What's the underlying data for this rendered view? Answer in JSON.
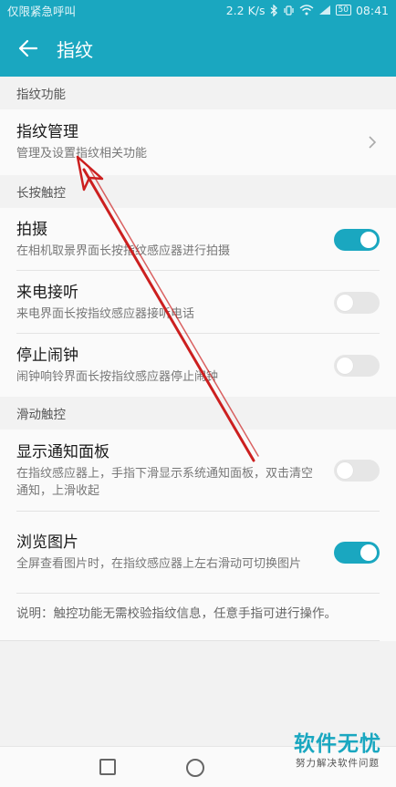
{
  "status_bar": {
    "left_text": "仅限紧急呼叫",
    "speed": "2.2 K/s",
    "icons": [
      "bluetooth-icon",
      "vibrate-icon",
      "wifi-icon",
      "signal-icon"
    ],
    "battery": "50",
    "time": "08:41"
  },
  "app_bar": {
    "back_icon": "arrow-left-icon",
    "title": "指纹"
  },
  "sections": {
    "s1": {
      "header": "指纹功能",
      "manage": {
        "title": "指纹管理",
        "subtitle": "管理及设置指纹相关功能"
      }
    },
    "s2": {
      "header": "长按触控",
      "photo": {
        "title": "拍摄",
        "subtitle": "在相机取景界面长按指纹感应器进行拍摄",
        "enabled": true
      },
      "call": {
        "title": "来电接听",
        "subtitle": "来电界面长按指纹感应器接听电话",
        "enabled": false
      },
      "alarm": {
        "title": "停止闹钟",
        "subtitle": "闹钟响铃界面长按指纹感应器停止闹钟",
        "enabled": false
      }
    },
    "s3": {
      "header": "滑动触控",
      "notify": {
        "title": "显示通知面板",
        "subtitle": "在指纹感应器上，手指下滑显示系统通知面板，双击清空通知，上滑收起",
        "enabled": false
      },
      "browse": {
        "title": "浏览图片",
        "subtitle": "全屏查看图片时，在指纹感应器上左右滑动可切换图片",
        "enabled": true
      }
    }
  },
  "note": "说明：触控功能无需校验指纹信息，任意手指可进行操作。",
  "nav_bar": {
    "buttons": [
      "recent-apps-icon",
      "home-icon"
    ]
  },
  "watermark": {
    "main": "软件无忧",
    "sub": "努力解决软件问题"
  },
  "colors": {
    "accent": "#1aa7c0",
    "annotation_arrow": "#cc1f1f"
  }
}
